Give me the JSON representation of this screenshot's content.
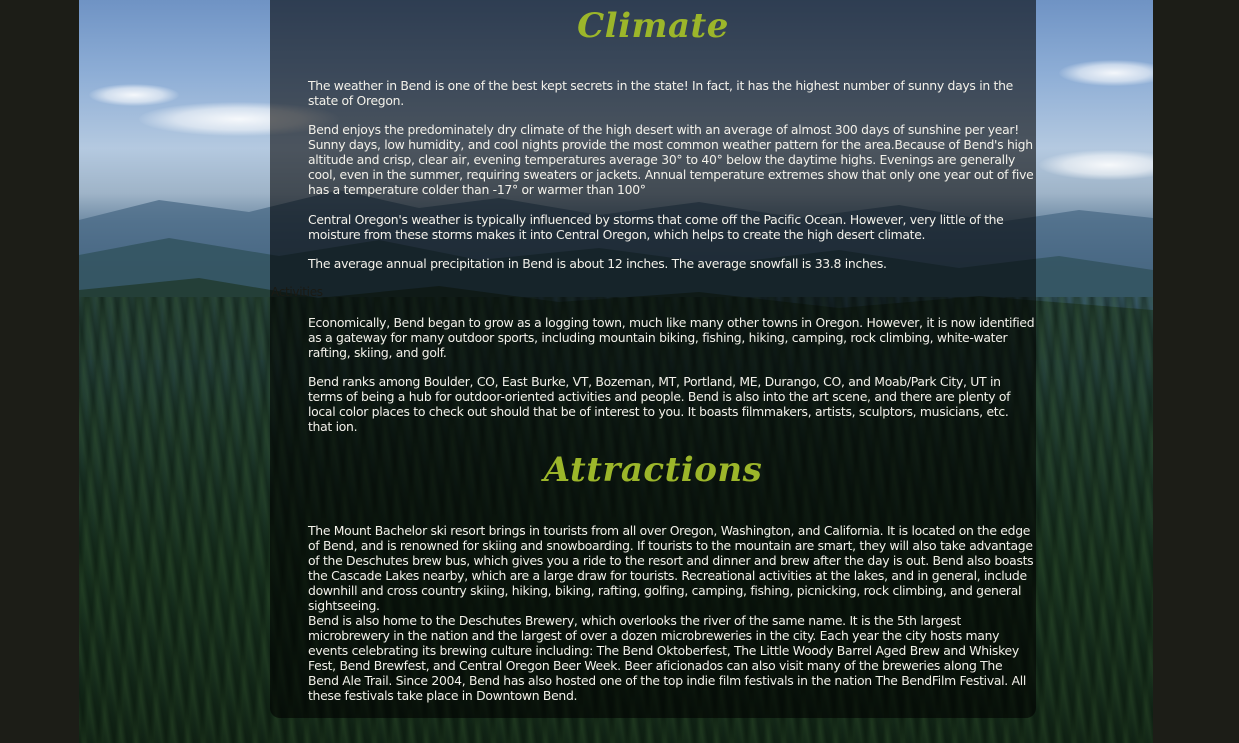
{
  "climate": {
    "heading": "Climate",
    "paragraphs": [
      "The weather in Bend is one of the best kept secrets in the state! In fact, it has the highest number of sunny days in the state of Oregon.",
      "Bend enjoys the predominately dry climate of the high desert with an average of almost 300 days of sunshine per year! Sunny days, low humidity, and cool nights provide the most common weather pattern for the area.Because of Bend's high altitude and crisp, clear air, evening temperatures average 30° to 40° below the daytime highs. Evenings are generally cool, even in the summer, requiring sweaters or jackets. Annual temperature extremes show that only one year out of five has a temperature colder than -17° or warmer than 100°",
      "Central Oregon's weather is typically influenced by storms that come off the Pacific Ocean. However, very little of the moisture from these storms makes it into Central Oregon, which helps to create the high desert climate.",
      "The average annual precipitation in Bend is about 12 inches. The average snowfall is 33.8 inches."
    ]
  },
  "activities": {
    "heading": "Activities",
    "paragraphs": [
      "Economically, Bend began to grow as a logging town, much like many other towns in Oregon. However, it is now identified as a gateway for many outdoor sports, including mountain biking, fishing, hiking, camping, rock climbing, white-water rafting, skiing, and golf.",
      "Bend ranks among Boulder, CO, East Burke, VT, Bozeman, MT, Portland, ME, Durango, CO, and Moab/Park City, UT in terms of being a hub for outdoor-oriented activities and people. Bend is also into the art scene, and there are plenty of local color places to check out should that be of interest to you. It boasts filmmakers, artists, sculptors, musicians, etc. that ion."
    ]
  },
  "attractions": {
    "heading": "Attractions",
    "paragraphs": [
      "The Mount Bachelor ski resort brings in tourists from all over Oregon, Washington, and California. It is located on the edge of Bend, and is renowned for skiing and snowboarding. If tourists to the mountain are smart, they will also take advantage of the Deschutes brew bus, which gives you a ride to the resort and dinner and brew after the day is out. Bend also boasts the Cascade Lakes nearby, which are a large draw for tourists. Recreational activities at the lakes, and in general, include downhill and cross country skiing, hiking, biking, rafting, golfing, camping, fishing, picnicking, rock climbing, and general sightseeing.",
      "Bend is also home to the Deschutes Brewery, which overlooks the river of the same name. It is the 5th largest microbrewery in the nation and the largest of over a dozen microbreweries in the city. Each year the city hosts many events celebrating its brewing culture including: The Bend Oktoberfest, The Little Woody Barrel Aged Brew and Whiskey Fest, Bend Brewfest, and Central Oregon Beer Week. Beer aficionados can also visit many of the breweries along The Bend Ale Trail. Since 2004, Bend has also hosted one of the top indie film festivals in the nation The BendFilm Festival. All these festivals take place in Downtown Bend."
    ]
  },
  "colors": {
    "heading": "#9cb62a",
    "body_text": "#f3f1ea",
    "page_background": "#1c1d17",
    "panel": "rgba(0,0,0,0.58)"
  }
}
